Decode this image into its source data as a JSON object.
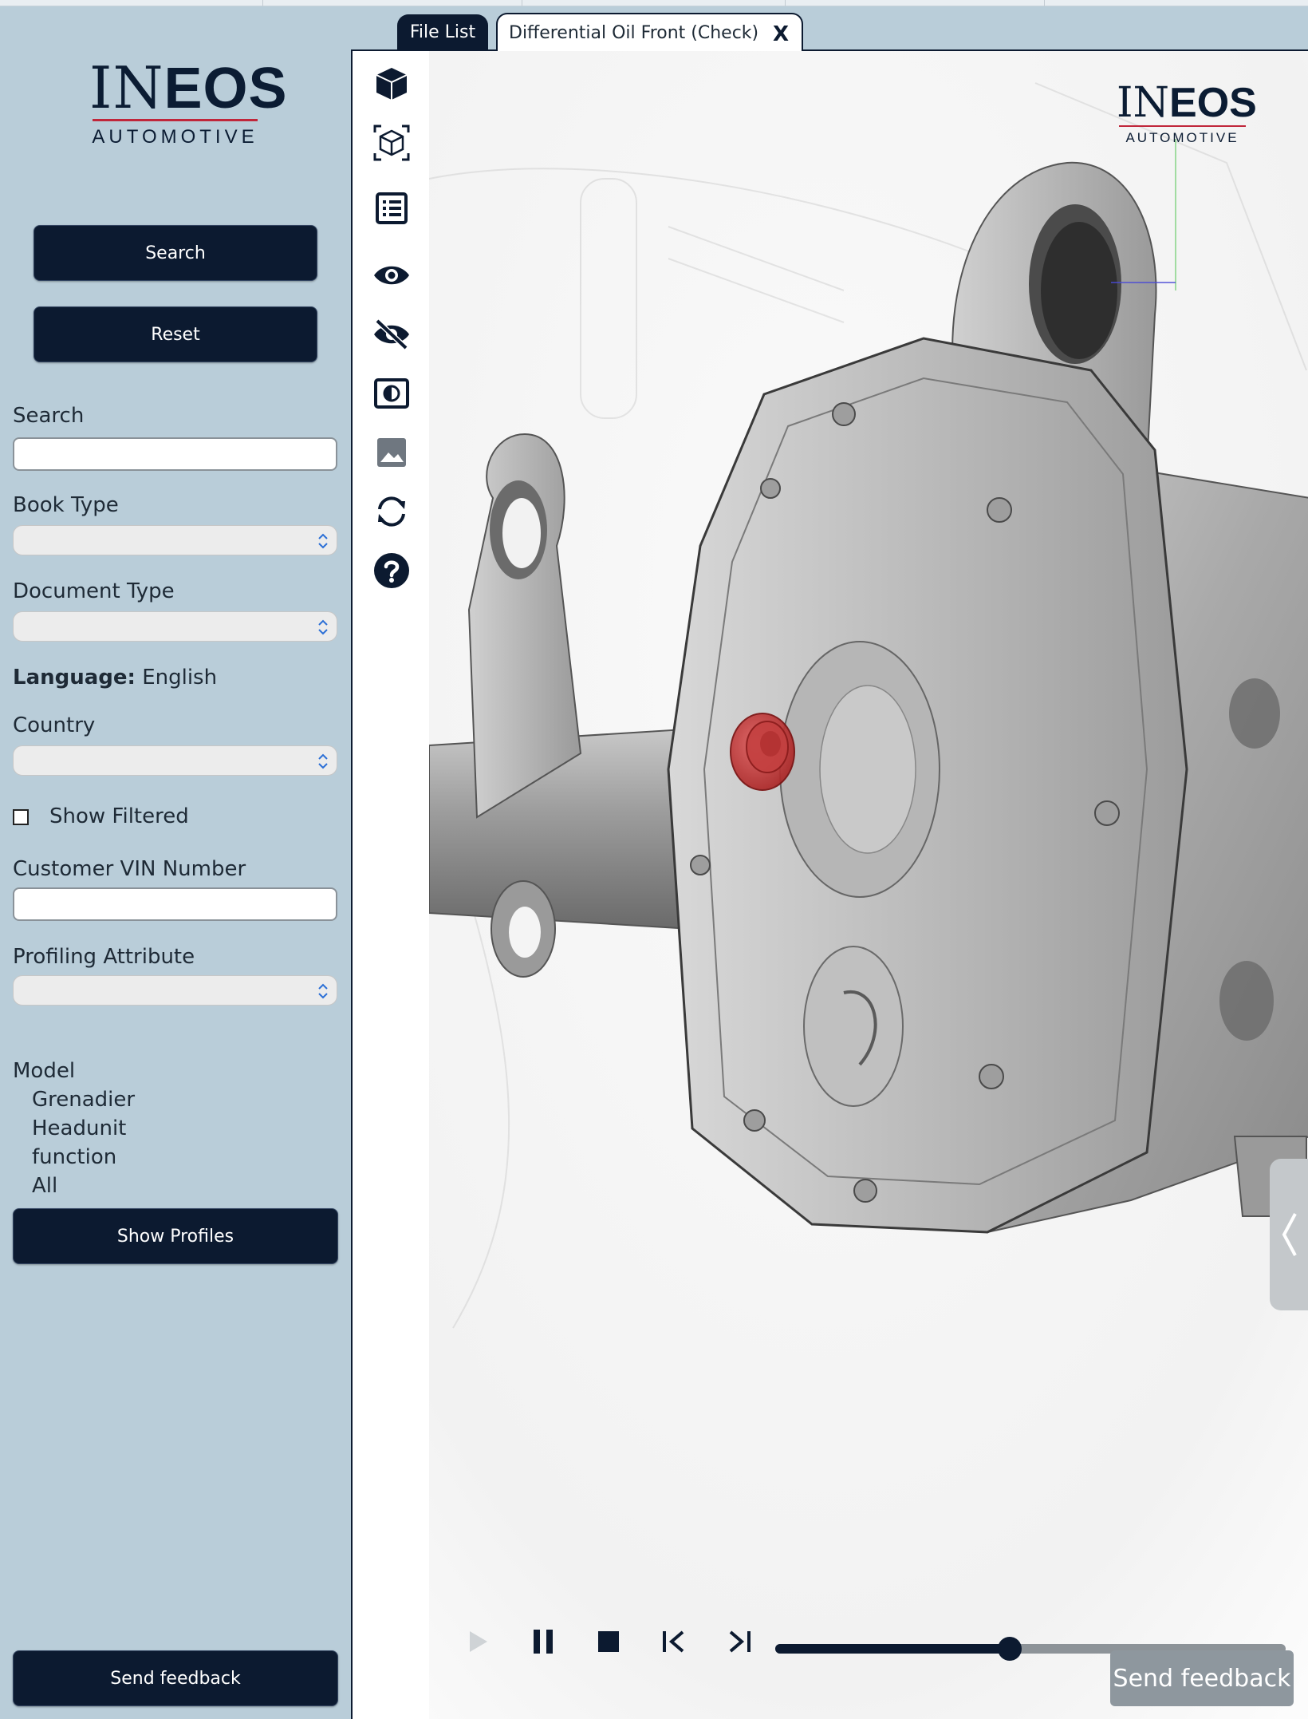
{
  "sidebar": {
    "logo": {
      "word_part1": "IN",
      "word_part2": "EOS",
      "subtitle": "AUTOMOTIVE"
    },
    "search_button": "Search",
    "reset_button": "Reset",
    "search_label": "Search",
    "search_value": "",
    "book_type_label": "Book Type",
    "document_type_label": "Document Type",
    "language_label": "Language:",
    "language_value": "English",
    "country_label": "Country",
    "show_filtered_label": "Show Filtered",
    "show_filtered_checked": false,
    "vin_label": "Customer VIN Number",
    "vin_value": "",
    "profiling_label": "Profiling Attribute",
    "model_header": "Model",
    "model_items": [
      "Grenadier",
      "Headunit",
      "function",
      "All"
    ],
    "show_profiles_button": "Show  Profiles",
    "send_feedback_button": "Send feedback"
  },
  "tabs": {
    "file_list": "File List",
    "document": "Differential Oil Front (Check)",
    "close": "X"
  },
  "viewer": {
    "logo": {
      "word_part1": "IN",
      "word_part2": "EOS",
      "subtitle": "AUTOMOTIVE"
    },
    "toolbar_icons": [
      "cube-icon",
      "isometric-cube-icon",
      "list-icon",
      "eye-icon",
      "eye-off-icon",
      "contrast-icon",
      "image-icon",
      "refresh-icon",
      "help-icon"
    ],
    "player": {
      "progress": 0.46
    },
    "send_feedback": "Send feedback"
  },
  "colors": {
    "navy": "#0c1a30",
    "sidebar_bg": "#b9cdd9",
    "accent_red": "#c0263a",
    "highlight_part": "#c0392b"
  }
}
